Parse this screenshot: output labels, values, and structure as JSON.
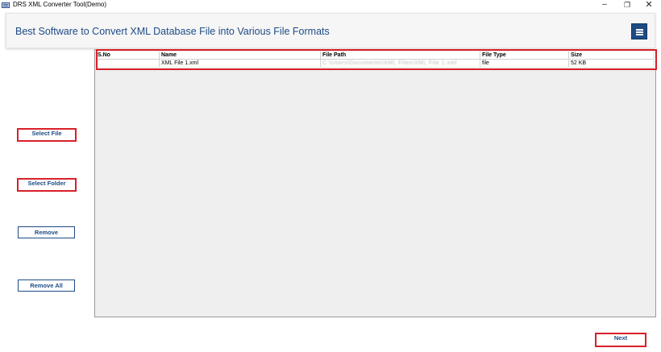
{
  "window": {
    "title": "DRS XML Converter Tool(Demo)",
    "minimize": "–",
    "restore": "❐",
    "close": "✕"
  },
  "header": {
    "title": "Best Software to Convert XML Database File into Various File Formats",
    "menu_icon": "hamburger-menu-icon"
  },
  "table": {
    "columns": [
      "S.No",
      "Name",
      "File Path",
      "File Type",
      "Size"
    ],
    "rows": [
      {
        "sno": "",
        "name": "XML File 1.xml",
        "path": "C:\\Users\\Documents\\XML Files\\XML File 1.xml",
        "type": "file",
        "size": "52 KB"
      }
    ]
  },
  "buttons": {
    "select_file": "Select File",
    "select_folder": "Select Folder",
    "remove": "Remove",
    "remove_all": "Remove All",
    "next": "Next"
  },
  "colors": {
    "accent": "#1d4b86",
    "highlight": "#d9202a",
    "panel_bg": "#efefef"
  }
}
